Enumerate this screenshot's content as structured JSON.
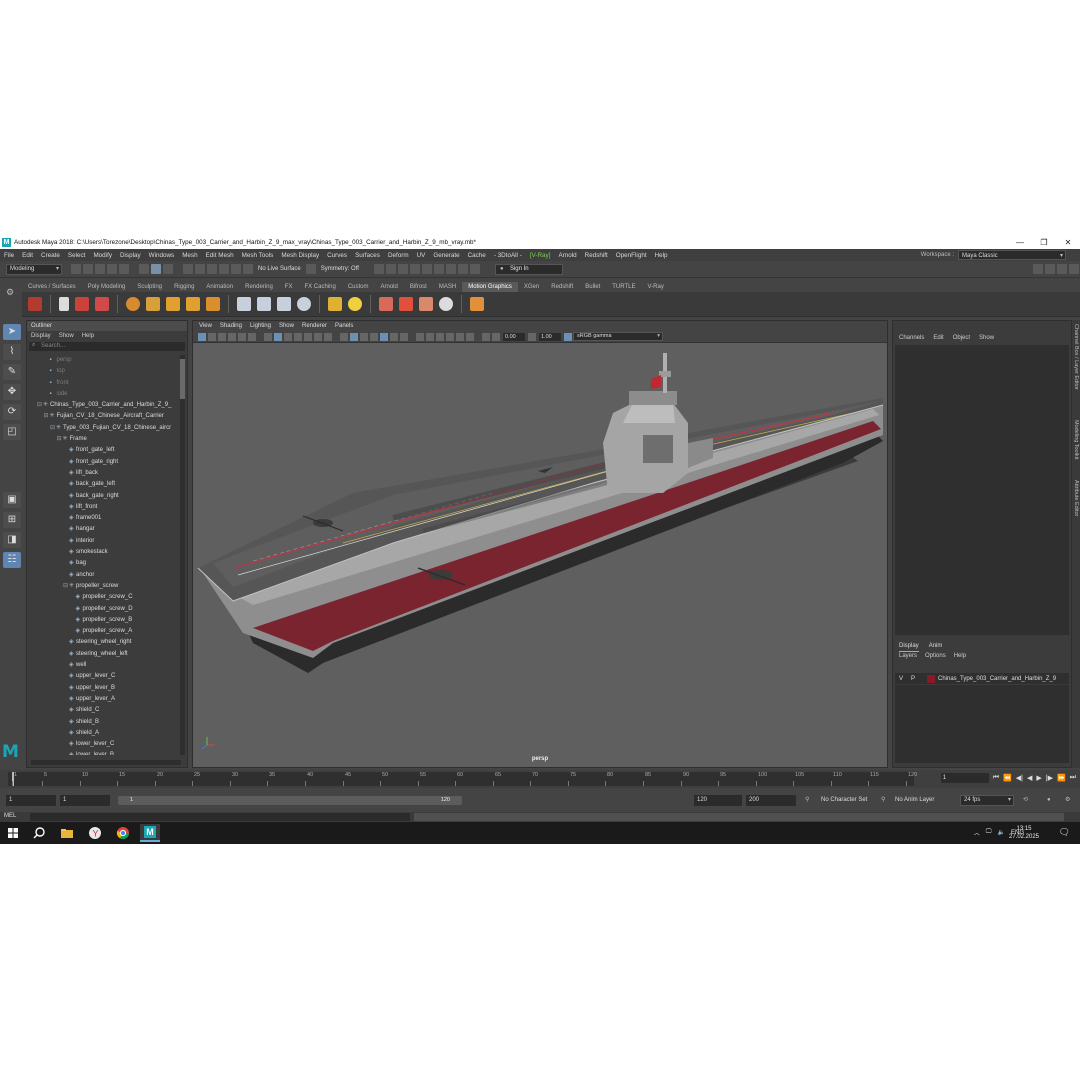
{
  "window": {
    "title": "Autodesk Maya 2018: C:\\Users\\Torezone\\Desktop\\Chinas_Type_003_Carrier_and_Harbin_Z_9_max_vray\\Chinas_Type_003_Carrier_and_Harbin_Z_9_mb_vray.mb*",
    "minimize": "—",
    "restore": "❐",
    "close": "✕"
  },
  "menubar": {
    "items": [
      "File",
      "Edit",
      "Create",
      "Select",
      "Modify",
      "Display",
      "Windows",
      "Mesh",
      "Edit Mesh",
      "Mesh Tools",
      "Mesh Display",
      "Curves",
      "Surfaces",
      "Deform",
      "UV",
      "Generate",
      "Cache",
      "- 3DtoAll -",
      "[V-Ray]",
      "Arnold",
      "Redshift",
      "OpenFlight",
      "Help"
    ],
    "workspace_label": "Workspace :",
    "workspace_value": "Maya Classic"
  },
  "statusline": {
    "mode": "Modeling",
    "live_surface": "No Live Surface",
    "symmetry": "Symmetry: Off",
    "sign_in": "Sign In"
  },
  "shelf": {
    "tabs": [
      "Curves / Surfaces",
      "Poly Modeling",
      "Sculpting",
      "Rigging",
      "Animation",
      "Rendering",
      "FX",
      "FX Caching",
      "Custom",
      "Arnold",
      "Bifrost",
      "MASH",
      "Motion Graphics",
      "XGen",
      "Redshift",
      "Bullet",
      "TURTLE",
      "V-Ray"
    ],
    "active_tab": "Motion Graphics"
  },
  "outliner": {
    "title": "Outliner",
    "menu": [
      "Display",
      "Show",
      "Help"
    ],
    "search_placeholder": "Search...",
    "items": [
      {
        "label": "persp",
        "indent": 1,
        "dim": true,
        "icon": "camera"
      },
      {
        "label": "top",
        "indent": 1,
        "dim": true,
        "icon": "camera"
      },
      {
        "label": "front",
        "indent": 1,
        "dim": true,
        "icon": "camera"
      },
      {
        "label": "side",
        "indent": 1,
        "dim": true,
        "icon": "camera"
      },
      {
        "label": "Chinas_Type_003_Carrier_and_Harbin_Z_9_",
        "indent": 0,
        "icon": "group",
        "expand": "⊟"
      },
      {
        "label": "Fujian_CV_18_Chinese_Aircraft_Carrier",
        "indent": 1,
        "icon": "group",
        "expand": "⊟"
      },
      {
        "label": "Type_003_Fujian_CV_18_Chinese_aircr",
        "indent": 2,
        "icon": "group",
        "expand": "⊟"
      },
      {
        "label": "Frame",
        "indent": 3,
        "icon": "group",
        "expand": "⊟"
      },
      {
        "label": "front_gate_left",
        "indent": 4,
        "icon": "mesh"
      },
      {
        "label": "front_gate_right",
        "indent": 4,
        "icon": "mesh"
      },
      {
        "label": "lift_back",
        "indent": 4,
        "icon": "mesh"
      },
      {
        "label": "back_gate_left",
        "indent": 4,
        "icon": "mesh"
      },
      {
        "label": "back_gate_right",
        "indent": 4,
        "icon": "mesh"
      },
      {
        "label": "lift_front",
        "indent": 4,
        "icon": "mesh"
      },
      {
        "label": "frame001",
        "indent": 4,
        "icon": "mesh"
      },
      {
        "label": "hangar",
        "indent": 4,
        "icon": "mesh"
      },
      {
        "label": "interior",
        "indent": 4,
        "icon": "mesh"
      },
      {
        "label": "smokestack",
        "indent": 4,
        "icon": "mesh"
      },
      {
        "label": "bag",
        "indent": 4,
        "icon": "mesh"
      },
      {
        "label": "anchor",
        "indent": 4,
        "icon": "mesh"
      },
      {
        "label": "propeller_screw",
        "indent": 4,
        "icon": "group",
        "expand": "⊟"
      },
      {
        "label": "propeller_screw_C",
        "indent": 5,
        "icon": "mesh"
      },
      {
        "label": "propeller_screw_D",
        "indent": 5,
        "icon": "mesh"
      },
      {
        "label": "propeller_screw_B",
        "indent": 5,
        "icon": "mesh"
      },
      {
        "label": "propeller_screw_A",
        "indent": 5,
        "icon": "mesh"
      },
      {
        "label": "steering_wheel_right",
        "indent": 4,
        "icon": "mesh"
      },
      {
        "label": "steering_wheel_left",
        "indent": 4,
        "icon": "mesh"
      },
      {
        "label": "well",
        "indent": 4,
        "icon": "mesh"
      },
      {
        "label": "upper_lever_C",
        "indent": 4,
        "icon": "mesh"
      },
      {
        "label": "upper_lever_B",
        "indent": 4,
        "icon": "mesh"
      },
      {
        "label": "upper_lever_A",
        "indent": 4,
        "icon": "mesh"
      },
      {
        "label": "shield_C",
        "indent": 4,
        "icon": "mesh"
      },
      {
        "label": "shield_B",
        "indent": 4,
        "icon": "mesh"
      },
      {
        "label": "shield_A",
        "indent": 4,
        "icon": "mesh"
      },
      {
        "label": "lower_lever_C",
        "indent": 4,
        "icon": "mesh"
      },
      {
        "label": "lower_lever_B",
        "indent": 4,
        "icon": "mesh"
      }
    ]
  },
  "viewport": {
    "menu": [
      "View",
      "Shading",
      "Lighting",
      "Show",
      "Renderer",
      "Panels"
    ],
    "exposure": "0.00",
    "gamma": "1.00",
    "color_space": "sRGB gamma",
    "camera_label": "persp"
  },
  "channelbox": {
    "menu": [
      "Channels",
      "Edit",
      "Object",
      "Show"
    ],
    "layer_tabs": [
      "Display",
      "Anim"
    ],
    "layer_menu": [
      "Layers",
      "Options",
      "Help"
    ],
    "layer_visible": "V",
    "layer_playback": "P",
    "layer_name": "Chinas_Type_003_Carrier_and_Harbin_Z_9",
    "layer_color": "#8b1a28",
    "side_tabs": [
      "Channel Box / Layer Editor",
      "Modeling Toolkit",
      "Attribute Editor"
    ]
  },
  "timeslider": {
    "ticks": [
      "1",
      "5",
      "10",
      "15",
      "20",
      "25",
      "30",
      "35",
      "40",
      "45",
      "50",
      "55",
      "60",
      "65",
      "70",
      "75",
      "80",
      "85",
      "90",
      "95",
      "100",
      "105",
      "110",
      "115",
      "120"
    ],
    "current_frame": "1"
  },
  "rangeslider": {
    "start": "1",
    "anim_start": "1",
    "range_start": "1",
    "range_end": "120",
    "anim_end": "120",
    "end": "200",
    "character_set": "No Character Set",
    "anim_layer": "No Anim Layer",
    "fps": "24 fps"
  },
  "commandline": {
    "lang": "MEL"
  },
  "taskbar": {
    "lang": "ENG",
    "time": "13:15",
    "date": "27.02.2025"
  }
}
